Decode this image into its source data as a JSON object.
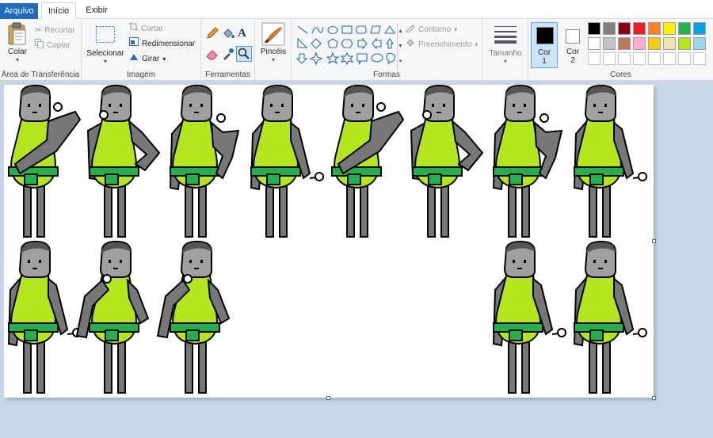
{
  "tabs": {
    "file": "Arquivo",
    "home": "Início",
    "view": "Exibir"
  },
  "clipboard": {
    "paste": "Colar",
    "cut": "Recortar",
    "copy": "Copiar",
    "label": "Área de Transferência"
  },
  "image": {
    "select": "Selecionar",
    "crop": "Cortar",
    "resize": "Redimensionar",
    "rotate": "Girar",
    "label": "Imagem"
  },
  "tools": {
    "label": "Ferramentas"
  },
  "brushes": {
    "label": "Pincéis"
  },
  "shapes": {
    "outline": "Contorno",
    "fill": "Preenchimento",
    "label": "Formas"
  },
  "size": {
    "label": "Tamanho"
  },
  "colors": {
    "color1": "Cor\n1",
    "color1_line1": "Cor",
    "color1_line2": "1",
    "color2_line1": "Cor",
    "color2_line2": "2",
    "label": "Cores",
    "current1": "#000000",
    "current2": "#ffffff",
    "row1": [
      "#000000",
      "#7f7f7f",
      "#880015",
      "#ed1c24",
      "#ff7f27",
      "#fff200",
      "#22b14c",
      "#00a2e8"
    ],
    "row2": [
      "#ffffff",
      "#c3c3c3",
      "#b97a57",
      "#ffaec9",
      "#ffc90e",
      "#efe4b0",
      "#b5e61d",
      "#99d9ea"
    ]
  },
  "figures": [
    {
      "pose": "wave",
      "row": 0,
      "col": 0
    },
    {
      "pose": "hip",
      "row": 0,
      "col": 1
    },
    {
      "pose": "stand",
      "row": 0,
      "col": 2
    },
    {
      "pose": "hold",
      "row": 0,
      "col": 3
    },
    {
      "pose": "wave",
      "row": 0,
      "col": 4
    },
    {
      "pose": "hip",
      "row": 0,
      "col": 5
    },
    {
      "pose": "stand",
      "row": 0,
      "col": 6
    },
    {
      "pose": "hold",
      "row": 0,
      "col": 7
    },
    {
      "pose": "hold",
      "row": 1,
      "col": 0
    },
    {
      "pose": "reach",
      "row": 1,
      "col": 1
    },
    {
      "pose": "reach",
      "row": 1,
      "col": 2
    },
    {
      "pose": "hold",
      "row": 1,
      "col": 6
    },
    {
      "pose": "hold",
      "row": 1,
      "col": 7
    }
  ]
}
